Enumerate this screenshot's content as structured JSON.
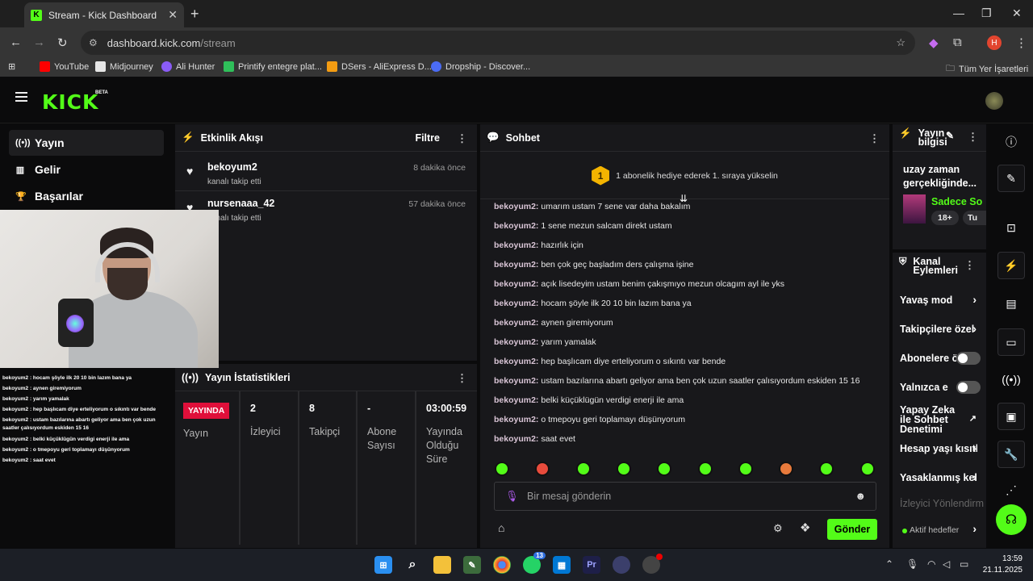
{
  "browser": {
    "tab_title": "Stream - Kick Dashboard",
    "url_host": "dashboard.kick.com",
    "url_path": "/stream",
    "bookmarks": [
      {
        "label": "YouTube",
        "color": "#ff0000"
      },
      {
        "label": "Midjourney",
        "color": "#e6e6e6"
      },
      {
        "label": "Ali Hunter",
        "color": "#8a5cf6"
      },
      {
        "label": "Printify entegre plat...",
        "color": "#2fbf5a"
      },
      {
        "label": "DSers - AliExpress D...",
        "color": "#f39c12"
      },
      {
        "label": "Dropship - Discover...",
        "color": "#4b6cf5"
      }
    ],
    "all_bookmarks": "Tüm Yer İşaretleri",
    "profile_initial": "H"
  },
  "kick": {
    "logo": "KICK",
    "beta": "BETA",
    "nav": [
      {
        "label": "Yayın",
        "icon": "broadcast-icon"
      },
      {
        "label": "Gelir",
        "icon": "chart-icon"
      },
      {
        "label": "Başarılar",
        "icon": "trophy-icon"
      }
    ],
    "overlay_chat": [
      {
        "user": "bekoyum2",
        "msg": " : hocam şöyle ilk 20 10 bin lazım bana ya"
      },
      {
        "user": "bekoyum2",
        "msg": " : aynen giremiyorum"
      },
      {
        "user": "bekoyum2",
        "msg": " : yarım yamalak"
      },
      {
        "user": "bekoyum2",
        "msg": " : hep başlıcam diye erteliyorum o sıkıntı var bende"
      },
      {
        "user": "bekoyum2",
        "msg": " : ustam bazılarına abartı geliyor ama ben çok uzun saatler çalısıyordum eskiden 15 16"
      },
      {
        "user": "bekoyum2",
        "msg": " : belki küçüklügün verdigi enerji ile ama"
      },
      {
        "user": "bekoyum2",
        "msg": " : o tmepoyu geri toplamayı düşünyorum"
      },
      {
        "user": "bekoyum2",
        "msg": " : saat evet"
      }
    ],
    "activity": {
      "title": "Etkinlik Akışı",
      "filter": "Filtre",
      "events": [
        {
          "name": "bekoyum2",
          "action": "kanalı takip etti",
          "time": "8 dakika önce"
        },
        {
          "name": "nursenaaa_42",
          "action": "kanalı takip etti",
          "time": "57 dakika önce"
        }
      ]
    },
    "stats": {
      "title": "Yayın İstatistikleri",
      "live_badge": "YAYINDA",
      "live_label": "Yayın",
      "viewers_value": "2",
      "viewers_label": "İzleyici",
      "followers_value": "8",
      "followers_label": "Takipçi",
      "subs_value": "-",
      "subs_label": "Abone Sayısı",
      "duration_value": "03:00:59",
      "duration_label": "Yayında Olduğu Süre"
    },
    "chat": {
      "title": "Sohbet",
      "banner": "1 abonelik hediye ederek 1. sıraya yükselin",
      "banner_rank": "1",
      "messages": [
        {
          "user": "bekoyum2:",
          "msg": "umarım ustam 7 sene var daha bakalım"
        },
        {
          "user": "bekoyum2:",
          "msg": "1 sene mezun salcam direkt ustam"
        },
        {
          "user": "bekoyum2:",
          "msg": "hazırlık için"
        },
        {
          "user": "bekoyum2:",
          "msg": "ben çok geç başladım ders çalışma işine"
        },
        {
          "user": "bekoyum2:",
          "msg": "açık lisedeyim ustam benim çakışmıyo mezun olcagım ayl ile yks"
        },
        {
          "user": "bekoyum2:",
          "msg": "hocam şöyle ilk 20 10 bin lazım bana ya"
        },
        {
          "user": "bekoyum2:",
          "msg": "aynen giremiyorum"
        },
        {
          "user": "bekoyum2:",
          "msg": "yarım yamalak"
        },
        {
          "user": "bekoyum2:",
          "msg": "hep başlıcam diye erteliyorum o sıkıntı var bende"
        },
        {
          "user": "bekoyum2:",
          "msg": "ustam bazılarına abartı geliyor ama ben çok uzun saatler çalısıyordum eskiden 15 16"
        },
        {
          "user": "bekoyum2:",
          "msg": "belki küçüklügün verdigi enerji ile ama"
        },
        {
          "user": "bekoyum2:",
          "msg": "o tmepoyu geri toplamayı düşünyorum"
        },
        {
          "user": "bekoyum2:",
          "msg": "saat evet"
        }
      ],
      "placeholder": "Bir mesaj gönderin",
      "send": "Gönder",
      "emote_colors": [
        "#53fc18",
        "#e84b3c",
        "#53fc18",
        "#53fc18",
        "#53fc18",
        "#53fc18",
        "#53fc18",
        "#e87a3c",
        "#53fc18",
        "#53fc18"
      ]
    },
    "stream_info": {
      "title": "Yayın bilgisi",
      "stream_title": "uzay zaman gerçekliğinde...",
      "category": "Sadece So",
      "tag_age": "18+",
      "tag_lang": "Tu"
    },
    "channel_actions": {
      "title": "Kanal Eylemleri",
      "items": [
        {
          "label": "Yavaş mod",
          "control": "chevron"
        },
        {
          "label": "Takipçilere özel",
          "control": "chevron"
        },
        {
          "label": "Abonelere özel",
          "control": "toggle"
        },
        {
          "label": "Yalnızca emote",
          "control": "toggle"
        },
        {
          "label": "Yapay Zeka ile Sohbet Denetimi",
          "control": "external"
        },
        {
          "label": "Hesap yaşı kısıtlaması",
          "control": "chevron"
        },
        {
          "label": "Yasaklanmış kelimeler",
          "control": "chevron"
        },
        {
          "label": "İzleyici Yönlendirme",
          "control": "none"
        },
        {
          "label": "Aktif hedefler",
          "control": "chevron"
        }
      ]
    }
  },
  "taskbar": {
    "time": "13:59",
    "date": "21.11.2025",
    "whatsapp_badge": "13"
  },
  "colors": {
    "accent": "#53fc18",
    "live": "#e00f3a",
    "panel": "#18181b"
  }
}
